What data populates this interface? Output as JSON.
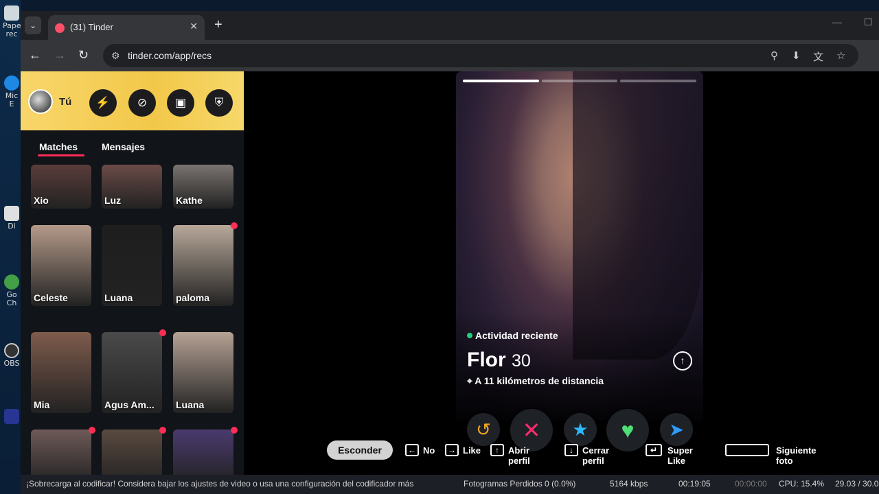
{
  "desktop": {
    "icons": [
      {
        "label": "Pape rec",
        "color": "#cfd8dc"
      },
      {
        "label": "Mic E",
        "color": "#1e88e5"
      },
      {
        "label": "Di",
        "color": "#e0e0e0"
      },
      {
        "label": "Go Ch",
        "color": "#43a047"
      },
      {
        "label": "OBS",
        "color": "#333"
      },
      {
        "label": "",
        "color": "#283593"
      }
    ]
  },
  "browser": {
    "tab_title": "(31) Tinder",
    "tab_close": "✕",
    "new_tab": "+",
    "url": "tinder.com/app/recs",
    "back": "←",
    "forward": "→",
    "reload": "↻",
    "minimize": "—",
    "maximize": "☐",
    "menu_toggle": "⌄",
    "site_info": "⚙",
    "actions": [
      "⚲",
      "⬇",
      "文",
      "☆"
    ]
  },
  "sidebar": {
    "me_label": "Tú",
    "header_buttons": [
      "⚡",
      "⊘",
      "▣",
      "⛨"
    ],
    "tabs": {
      "matches": "Matches",
      "messages": "Mensajes"
    },
    "matches": [
      {
        "name": "Xio",
        "unread": false,
        "color": "#5a3d3a"
      },
      {
        "name": "Luz",
        "unread": false,
        "color": "#6a4b47"
      },
      {
        "name": "Kathe",
        "unread": false,
        "color": "#7a7470"
      },
      {
        "name": "Celeste",
        "unread": false,
        "color": "#b59a8a"
      },
      {
        "name": "Luana",
        "unread": false,
        "color": "#1e1e1e"
      },
      {
        "name": "paloma",
        "unread": true,
        "color": "#b8a89a"
      },
      {
        "name": "Mia",
        "unread": false,
        "color": "#7e5b4c"
      },
      {
        "name": "Agus Am...",
        "unread": true,
        "color": "#4a4a4a"
      },
      {
        "name": "Luana",
        "unread": false,
        "color": "#b6a294"
      },
      {
        "name": "",
        "unread": true,
        "color": "#6e5a58"
      },
      {
        "name": "",
        "unread": true,
        "color": "#5a4a40"
      },
      {
        "name": "",
        "unread": true,
        "color": "#4a3a6e"
      }
    ]
  },
  "profile": {
    "activity": "Actividad reciente",
    "name": "Flor",
    "age": "30",
    "distance": "A 11 kilómetros de distancia",
    "info_icon": "↑",
    "photo_count": 3,
    "current_photo": 1
  },
  "actions": {
    "rewind": "↺",
    "nope": "✕",
    "superlike": "★",
    "like": "♥",
    "boost": "➤"
  },
  "shortcuts": {
    "hide": "Esconder",
    "no_key": "←",
    "no": "No",
    "like_key": "→",
    "like": "Like",
    "open_key": "↑",
    "open": "Abrir perfil",
    "close_key": "↓",
    "close": "Cerrar perfil",
    "superlike_key": "↵",
    "superlike": "Super Like",
    "next": "Siguiente foto"
  },
  "status_bar": {
    "warning": "¡Sobrecarga al codificar! Considera bajar los ajustes de video o usa una configuración del codificador más",
    "dropped": "Fotogramas Perdidos 0 (0.0%)",
    "bitrate": "5164 kbps",
    "rec_time": "00:19:05",
    "stream_time": "00:00:00",
    "cpu": "CPU: 15.4%",
    "fps": "29.03 / 30.0"
  }
}
